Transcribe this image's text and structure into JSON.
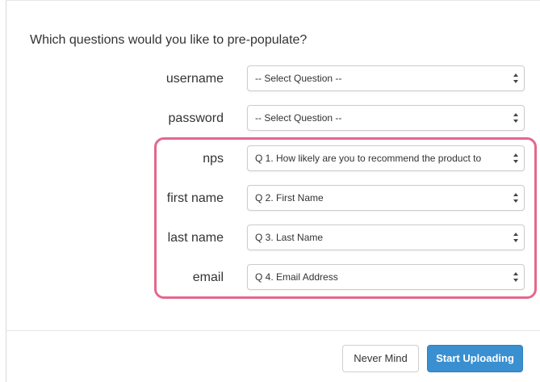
{
  "dialog": {
    "title": "Which questions would you like to pre-populate?"
  },
  "fields": [
    {
      "label": "username",
      "selected": "-- Select Question --"
    },
    {
      "label": "password",
      "selected": "-- Select Question --"
    },
    {
      "label": "nps",
      "selected": "Q 1. How likely are you to recommend the product to"
    },
    {
      "label": "first name",
      "selected": "Q 2. First Name"
    },
    {
      "label": "last name",
      "selected": "Q 3. Last Name"
    },
    {
      "label": "email",
      "selected": "Q 4. Email Address"
    }
  ],
  "highlight": {
    "color": "#e4678d"
  },
  "footer": {
    "cancel_label": "Never Mind",
    "submit_label": "Start Uploading",
    "submit_color": "#3a8fd1"
  },
  "icons": {
    "select_arrow": "sort-arrows-icon"
  }
}
